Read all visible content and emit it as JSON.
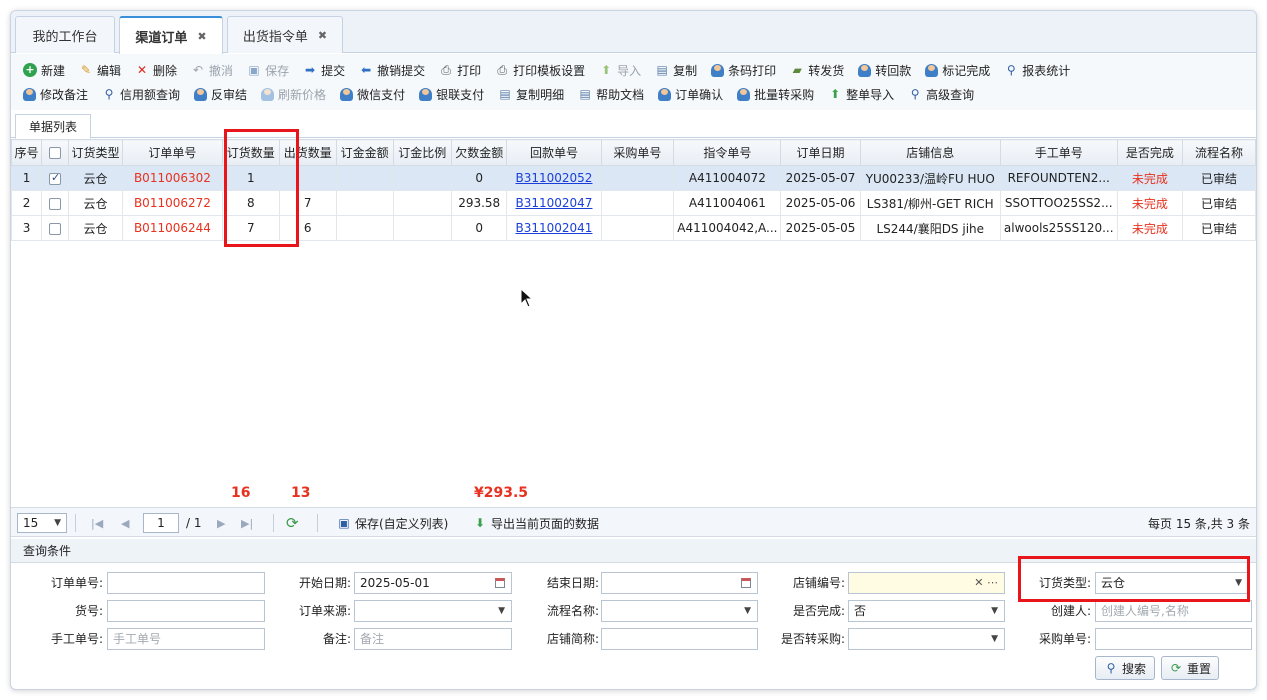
{
  "tabs": [
    {
      "label": "我的工作台",
      "closable": false
    },
    {
      "label": "渠道订单",
      "closable": true,
      "active": true
    },
    {
      "label": "出货指令单",
      "closable": true
    }
  ],
  "tab_close_glyph": "✖",
  "toolbar": {
    "row1": [
      "新建",
      "编辑",
      "删除",
      "撤消",
      "保存",
      "提交",
      "撤销提交",
      "打印",
      "打印模板设置",
      "导入",
      "复制",
      "条码打印",
      "转发货",
      "转回款",
      "标记完成",
      "报表统计"
    ],
    "row2": [
      "修改备注",
      "信用额查询",
      "反审结",
      "刷新价格",
      "微信支付",
      "银联支付",
      "复制明细",
      "帮助文档",
      "订单确认",
      "批量转采购",
      "整单导入",
      "高级查询"
    ]
  },
  "subtab": "单据列表",
  "grid": {
    "headers": [
      "序号",
      "",
      "订货类型",
      "订单单号",
      "订货数量",
      "出货数量",
      "订金金额",
      "订金比例",
      "欠数金额",
      "回款单号",
      "采购单号",
      "指令单号",
      "订单日期",
      "店铺信息",
      "手工单号",
      "是否完成",
      "流程名称"
    ],
    "rows": [
      {
        "no": "1",
        "checked": true,
        "type": "云仓",
        "order": "B011006302",
        "qty": "1",
        "ship": "",
        "deposit": "",
        "ratio": "",
        "owed": "0",
        "refund": "B311002052",
        "purchase": "",
        "cmd": "A411004072",
        "date": "2025-05-07",
        "shop": "YU00233/温岭FU HUO",
        "manual": "REFOUNDTEN2...",
        "done": "未完成",
        "flow": "已审结"
      },
      {
        "no": "2",
        "checked": false,
        "type": "云仓",
        "order": "B011006272",
        "qty": "8",
        "ship": "7",
        "deposit": "",
        "ratio": "",
        "owed": "293.58",
        "refund": "B311002047",
        "purchase": "",
        "cmd": "A411004061",
        "date": "2025-05-06",
        "shop": "LS381/柳州-GET RICH",
        "manual": "SSOTTOO25SS2...",
        "done": "未完成",
        "flow": "已审结"
      },
      {
        "no": "3",
        "checked": false,
        "type": "云仓",
        "order": "B011006244",
        "qty": "7",
        "ship": "6",
        "deposit": "",
        "ratio": "",
        "owed": "0",
        "refund": "B311002041",
        "purchase": "",
        "cmd": "A411004042,A...",
        "date": "2025-05-05",
        "shop": "LS244/襄阳DS jihe",
        "manual": "alwools25SS120...",
        "done": "未完成",
        "flow": "已审结"
      }
    ]
  },
  "totals": {
    "qty": "16",
    "ship": "13",
    "owed": "¥293.5"
  },
  "pager": {
    "page_size": "15",
    "page": "1",
    "page_total": "/ 1",
    "save_custom": "保存(自定义列表)",
    "export": "导出当前页面的数据",
    "summary": "每页 15 条,共 3 条"
  },
  "query": {
    "title": "查询条件",
    "fields": {
      "order_no": {
        "label": "订单单号:",
        "value": ""
      },
      "start_date": {
        "label": "开始日期:",
        "value": "2025-05-01"
      },
      "end_date": {
        "label": "结束日期:",
        "value": ""
      },
      "shop_code": {
        "label": "店铺编号:",
        "value": ""
      },
      "order_type": {
        "label": "订货类型:",
        "value": "云仓"
      },
      "goods_no": {
        "label": "货号:",
        "value": ""
      },
      "order_source": {
        "label": "订单来源:",
        "value": ""
      },
      "flow_name": {
        "label": "流程名称:",
        "value": ""
      },
      "is_done": {
        "label": "是否完成:",
        "value": "否"
      },
      "creator": {
        "label": "创建人:",
        "placeholder": "创建人编号,名称"
      },
      "manual_no": {
        "label": "手工单号:",
        "placeholder": "手工单号"
      },
      "remark": {
        "label": "备注:",
        "placeholder": "备注"
      },
      "shop_short": {
        "label": "店铺简称:",
        "value": ""
      },
      "to_purchase": {
        "label": "是否转采购:",
        "value": ""
      },
      "purchase_no": {
        "label": "采购单号:",
        "value": ""
      }
    },
    "search_button": "搜索",
    "reset_button": "重置"
  },
  "colors": {
    "accent": "#3b8fd9",
    "highlight": "#e8151b",
    "red_text": "#e8311e",
    "link": "#1a3fd8"
  }
}
